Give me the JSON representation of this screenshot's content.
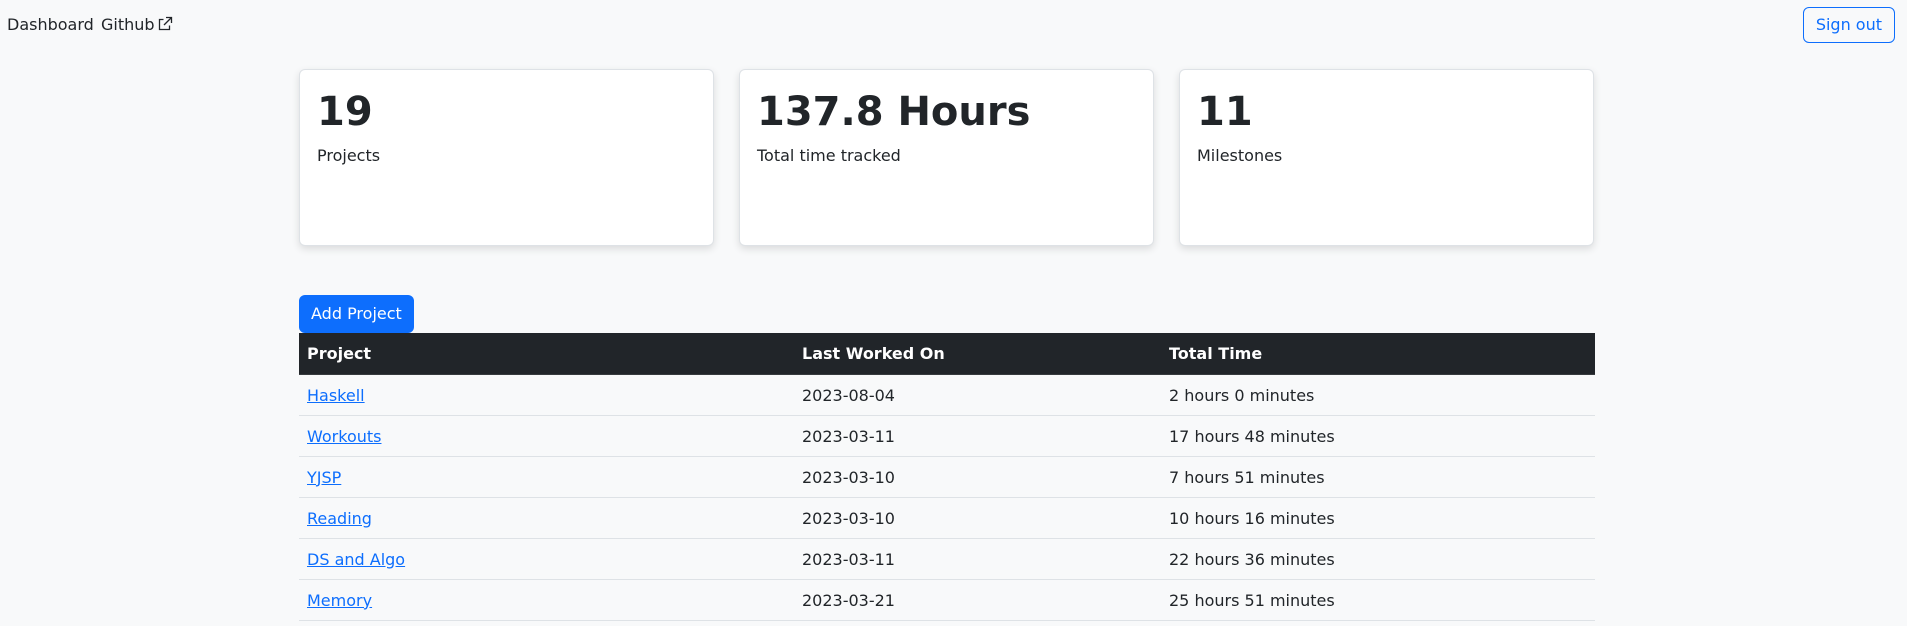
{
  "nav": {
    "dashboard_label": "Dashboard",
    "github_label": "Github",
    "signout_label": "Sign out"
  },
  "stats": [
    {
      "value": "19",
      "label": "Projects"
    },
    {
      "value": "137.8 Hours",
      "label": "Total time tracked"
    },
    {
      "value": "11",
      "label": "Milestones"
    }
  ],
  "add_project_label": "Add Project",
  "table": {
    "headers": [
      "Project",
      "Last Worked On",
      "Total Time"
    ],
    "rows": [
      {
        "project": "Haskell",
        "last": "2023-08-04",
        "total": "2 hours 0 minutes"
      },
      {
        "project": "Workouts",
        "last": "2023-03-11",
        "total": "17 hours 48 minutes"
      },
      {
        "project": "YJSP",
        "last": "2023-03-10",
        "total": "7 hours 51 minutes"
      },
      {
        "project": "Reading",
        "last": "2023-03-10",
        "total": "10 hours 16 minutes"
      },
      {
        "project": "DS and Algo",
        "last": "2023-03-11",
        "total": "22 hours 36 minutes"
      },
      {
        "project": "Memory",
        "last": "2023-03-21",
        "total": "25 hours 51 minutes"
      }
    ]
  },
  "icons": {
    "github_external": "external-link-icon"
  },
  "colors": {
    "accent": "#0d6efd",
    "table_header": "#212529",
    "background": "#f8f9fa"
  }
}
